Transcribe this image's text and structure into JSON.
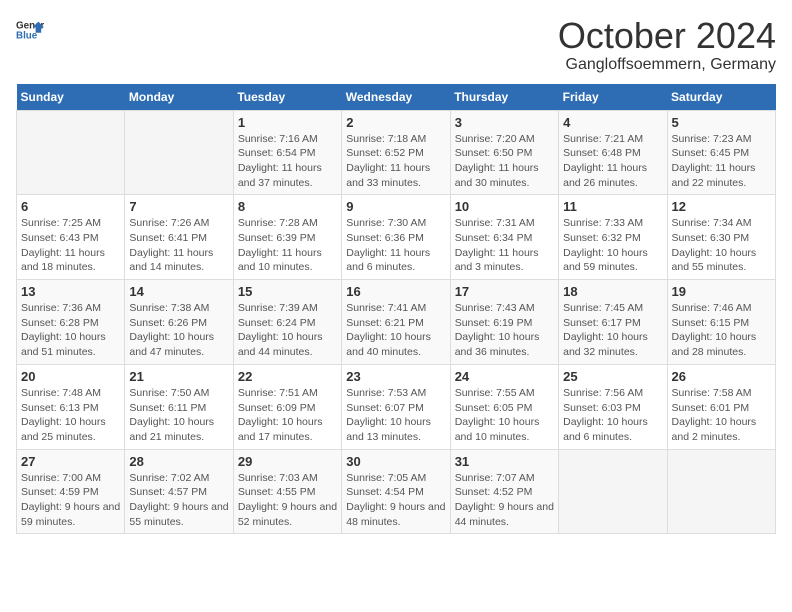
{
  "logo": {
    "text_general": "General",
    "text_blue": "Blue"
  },
  "title": "October 2024",
  "subtitle": "Gangloffsoemmern, Germany",
  "days_of_week": [
    "Sunday",
    "Monday",
    "Tuesday",
    "Wednesday",
    "Thursday",
    "Friday",
    "Saturday"
  ],
  "weeks": [
    [
      {
        "day": "",
        "info": ""
      },
      {
        "day": "",
        "info": ""
      },
      {
        "day": "1",
        "info": "Sunrise: 7:16 AM\nSunset: 6:54 PM\nDaylight: 11 hours and 37 minutes."
      },
      {
        "day": "2",
        "info": "Sunrise: 7:18 AM\nSunset: 6:52 PM\nDaylight: 11 hours and 33 minutes."
      },
      {
        "day": "3",
        "info": "Sunrise: 7:20 AM\nSunset: 6:50 PM\nDaylight: 11 hours and 30 minutes."
      },
      {
        "day": "4",
        "info": "Sunrise: 7:21 AM\nSunset: 6:48 PM\nDaylight: 11 hours and 26 minutes."
      },
      {
        "day": "5",
        "info": "Sunrise: 7:23 AM\nSunset: 6:45 PM\nDaylight: 11 hours and 22 minutes."
      }
    ],
    [
      {
        "day": "6",
        "info": "Sunrise: 7:25 AM\nSunset: 6:43 PM\nDaylight: 11 hours and 18 minutes."
      },
      {
        "day": "7",
        "info": "Sunrise: 7:26 AM\nSunset: 6:41 PM\nDaylight: 11 hours and 14 minutes."
      },
      {
        "day": "8",
        "info": "Sunrise: 7:28 AM\nSunset: 6:39 PM\nDaylight: 11 hours and 10 minutes."
      },
      {
        "day": "9",
        "info": "Sunrise: 7:30 AM\nSunset: 6:36 PM\nDaylight: 11 hours and 6 minutes."
      },
      {
        "day": "10",
        "info": "Sunrise: 7:31 AM\nSunset: 6:34 PM\nDaylight: 11 hours and 3 minutes."
      },
      {
        "day": "11",
        "info": "Sunrise: 7:33 AM\nSunset: 6:32 PM\nDaylight: 10 hours and 59 minutes."
      },
      {
        "day": "12",
        "info": "Sunrise: 7:34 AM\nSunset: 6:30 PM\nDaylight: 10 hours and 55 minutes."
      }
    ],
    [
      {
        "day": "13",
        "info": "Sunrise: 7:36 AM\nSunset: 6:28 PM\nDaylight: 10 hours and 51 minutes."
      },
      {
        "day": "14",
        "info": "Sunrise: 7:38 AM\nSunset: 6:26 PM\nDaylight: 10 hours and 47 minutes."
      },
      {
        "day": "15",
        "info": "Sunrise: 7:39 AM\nSunset: 6:24 PM\nDaylight: 10 hours and 44 minutes."
      },
      {
        "day": "16",
        "info": "Sunrise: 7:41 AM\nSunset: 6:21 PM\nDaylight: 10 hours and 40 minutes."
      },
      {
        "day": "17",
        "info": "Sunrise: 7:43 AM\nSunset: 6:19 PM\nDaylight: 10 hours and 36 minutes."
      },
      {
        "day": "18",
        "info": "Sunrise: 7:45 AM\nSunset: 6:17 PM\nDaylight: 10 hours and 32 minutes."
      },
      {
        "day": "19",
        "info": "Sunrise: 7:46 AM\nSunset: 6:15 PM\nDaylight: 10 hours and 28 minutes."
      }
    ],
    [
      {
        "day": "20",
        "info": "Sunrise: 7:48 AM\nSunset: 6:13 PM\nDaylight: 10 hours and 25 minutes."
      },
      {
        "day": "21",
        "info": "Sunrise: 7:50 AM\nSunset: 6:11 PM\nDaylight: 10 hours and 21 minutes."
      },
      {
        "day": "22",
        "info": "Sunrise: 7:51 AM\nSunset: 6:09 PM\nDaylight: 10 hours and 17 minutes."
      },
      {
        "day": "23",
        "info": "Sunrise: 7:53 AM\nSunset: 6:07 PM\nDaylight: 10 hours and 13 minutes."
      },
      {
        "day": "24",
        "info": "Sunrise: 7:55 AM\nSunset: 6:05 PM\nDaylight: 10 hours and 10 minutes."
      },
      {
        "day": "25",
        "info": "Sunrise: 7:56 AM\nSunset: 6:03 PM\nDaylight: 10 hours and 6 minutes."
      },
      {
        "day": "26",
        "info": "Sunrise: 7:58 AM\nSunset: 6:01 PM\nDaylight: 10 hours and 2 minutes."
      }
    ],
    [
      {
        "day": "27",
        "info": "Sunrise: 7:00 AM\nSunset: 4:59 PM\nDaylight: 9 hours and 59 minutes."
      },
      {
        "day": "28",
        "info": "Sunrise: 7:02 AM\nSunset: 4:57 PM\nDaylight: 9 hours and 55 minutes."
      },
      {
        "day": "29",
        "info": "Sunrise: 7:03 AM\nSunset: 4:55 PM\nDaylight: 9 hours and 52 minutes."
      },
      {
        "day": "30",
        "info": "Sunrise: 7:05 AM\nSunset: 4:54 PM\nDaylight: 9 hours and 48 minutes."
      },
      {
        "day": "31",
        "info": "Sunrise: 7:07 AM\nSunset: 4:52 PM\nDaylight: 9 hours and 44 minutes."
      },
      {
        "day": "",
        "info": ""
      },
      {
        "day": "",
        "info": ""
      }
    ]
  ]
}
